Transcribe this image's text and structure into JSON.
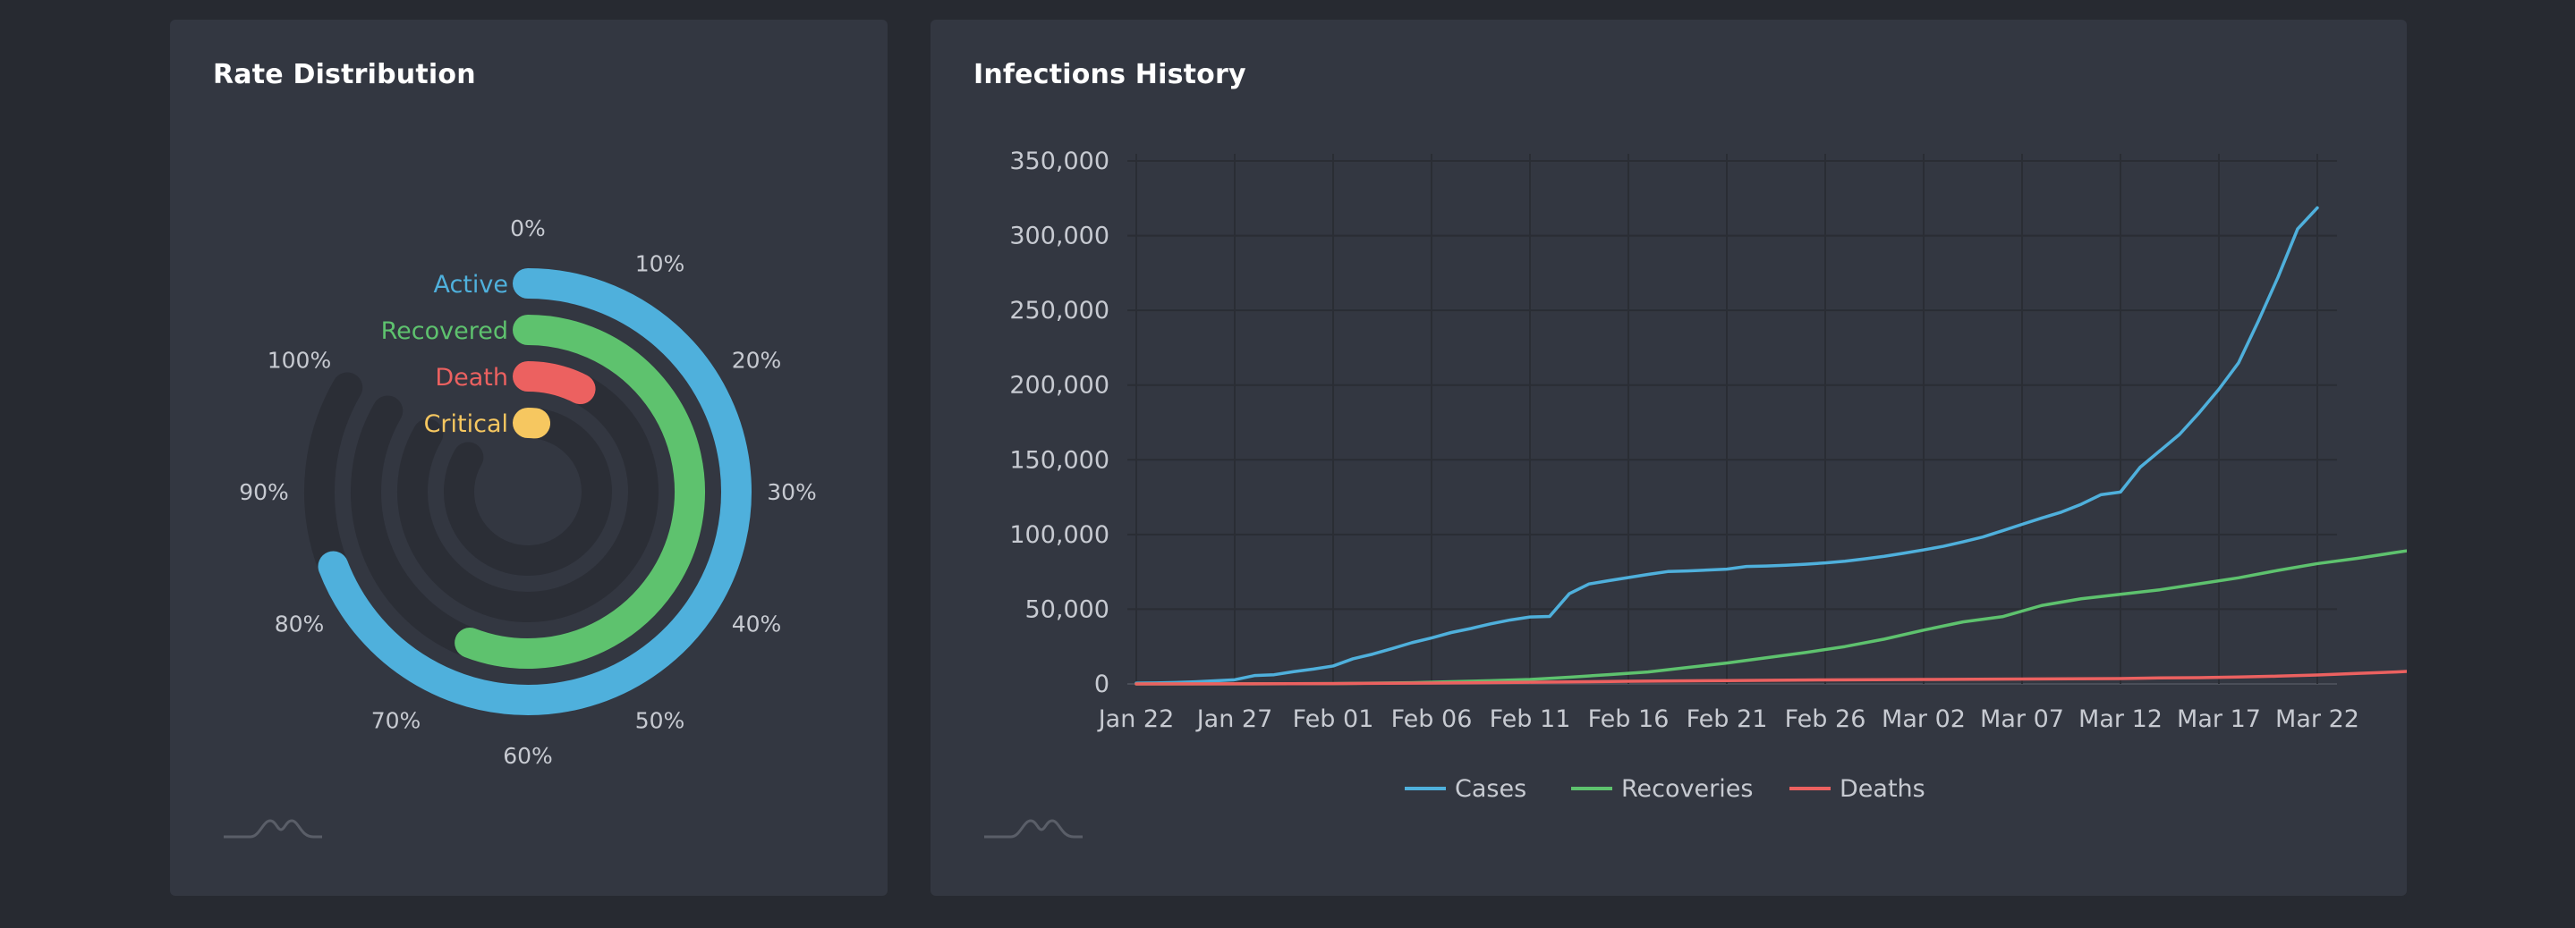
{
  "radial_card": {
    "title": "Rate Distribution"
  },
  "history_card": {
    "title": "Infections History"
  },
  "colors": {
    "background": "#272a31",
    "card": "#333741",
    "cases": "#4fb0dc",
    "recoveries": "#5ec26e",
    "deaths": "#ec6160",
    "critical": "#f6c760",
    "track": "#2b2e36",
    "grid": "#2a2d34",
    "text": "#c7cad1"
  },
  "chart_data": [
    {
      "type": "radialBar",
      "title": "Rate Distribution",
      "angle_axis_labels": [
        "0%",
        "10%",
        "20%",
        "30%",
        "40%",
        "50%",
        "60%",
        "70%",
        "80%",
        "90%",
        "100%"
      ],
      "angle_range_percent": [
        0,
        100
      ],
      "series": [
        {
          "name": "Active",
          "value": 83,
          "color": "#4fb0dc"
        },
        {
          "name": "Recovered",
          "value": 67,
          "color": "#5ec26e"
        },
        {
          "name": "Death",
          "value": 9,
          "color": "#ec6160"
        },
        {
          "name": "Critical",
          "value": 2,
          "color": "#f6c760"
        }
      ]
    },
    {
      "type": "line",
      "title": "Infections History",
      "x_tick_labels": [
        "Jan 22",
        "Jan 27",
        "Feb 01",
        "Feb 06",
        "Feb 11",
        "Feb 16",
        "Feb 21",
        "Feb 26",
        "Mar 02",
        "Mar 07",
        "Mar 12",
        "Mar 17",
        "Mar 22"
      ],
      "y_tick_labels": [
        "0",
        "50,000",
        "100,000",
        "150,000",
        "200,000",
        "250,000",
        "300,000",
        "350,000"
      ],
      "ylim": [
        0,
        350000
      ],
      "x_start": "2020-01-22",
      "grid": true,
      "legend_position": "bottom-center",
      "series": [
        {
          "name": "Cases",
          "color": "#4fb0dc",
          "points": [
            [
              0,
              555
            ],
            [
              1,
              650
            ],
            [
              2,
              940
            ],
            [
              3,
              1430
            ],
            [
              4,
              2120
            ],
            [
              5,
              2800
            ],
            [
              6,
              5580
            ],
            [
              7,
              6170
            ],
            [
              8,
              8240
            ],
            [
              9,
              9930
            ],
            [
              10,
              12000
            ],
            [
              11,
              16800
            ],
            [
              12,
              19900
            ],
            [
              13,
              23700
            ],
            [
              14,
              27600
            ],
            [
              15,
              30800
            ],
            [
              16,
              34400
            ],
            [
              17,
              37100
            ],
            [
              18,
              40200
            ],
            [
              19,
              42800
            ],
            [
              20,
              44800
            ],
            [
              21,
              45200
            ],
            [
              22,
              60400
            ],
            [
              23,
              66900
            ],
            [
              24,
              69100
            ],
            [
              25,
              71200
            ],
            [
              26,
              73300
            ],
            [
              27,
              75200
            ],
            [
              28,
              75600
            ],
            [
              29,
              76200
            ],
            [
              30,
              76800
            ],
            [
              31,
              78600
            ],
            [
              32,
              78900
            ],
            [
              33,
              79400
            ],
            [
              34,
              80100
            ],
            [
              35,
              81000
            ],
            [
              36,
              82100
            ],
            [
              37,
              83700
            ],
            [
              38,
              85400
            ],
            [
              39,
              87500
            ],
            [
              40,
              89700
            ],
            [
              41,
              92100
            ],
            [
              42,
              95100
            ],
            [
              43,
              98300
            ],
            [
              44,
              102500
            ],
            [
              45,
              106800
            ],
            [
              46,
              111000
            ],
            [
              47,
              115000
            ],
            [
              48,
              120200
            ],
            [
              49,
              126600
            ],
            [
              50,
              128400
            ],
            [
              51,
              145000
            ],
            [
              52,
              156000
            ],
            [
              53,
              167000
            ],
            [
              54,
              181500
            ],
            [
              55,
              197200
            ],
            [
              56,
              214900
            ],
            [
              57,
              242700
            ],
            [
              58,
              272100
            ],
            [
              59,
              304500
            ],
            [
              60,
              318600
            ]
          ]
        },
        {
          "name": "Recoveries",
          "color": "#5ec26e",
          "points": [
            [
              0,
              28
            ],
            [
              5,
              60
            ],
            [
              10,
              240
            ],
            [
              12,
              500
            ],
            [
              14,
              800
            ],
            [
              16,
              1500
            ],
            [
              18,
              2200
            ],
            [
              20,
              3000
            ],
            [
              22,
              4500
            ],
            [
              24,
              6200
            ],
            [
              26,
              8000
            ],
            [
              28,
              11000
            ],
            [
              30,
              14000
            ],
            [
              32,
              17500
            ],
            [
              34,
              21000
            ],
            [
              36,
              25000
            ],
            [
              38,
              30000
            ],
            [
              40,
              36000
            ],
            [
              42,
              41500
            ],
            [
              44,
              45000
            ],
            [
              46,
              52500
            ],
            [
              48,
              57000
            ],
            [
              50,
              60000
            ],
            [
              52,
              63000
            ],
            [
              54,
              67000
            ],
            [
              56,
              71000
            ],
            [
              58,
              76000
            ],
            [
              60,
              80500
            ],
            [
              62,
              84000
            ],
            [
              64,
              88000
            ],
            [
              66,
              92000
            ],
            [
              68,
              95000
            ]
          ]
        },
        {
          "name": "Deaths",
          "color": "#ec6160",
          "points": [
            [
              0,
              17
            ],
            [
              5,
              80
            ],
            [
              10,
              260
            ],
            [
              15,
              560
            ],
            [
              20,
              1100
            ],
            [
              25,
              1770
            ],
            [
              30,
              2250
            ],
            [
              35,
              2700
            ],
            [
              40,
              3000
            ],
            [
              45,
              3300
            ],
            [
              50,
              3600
            ],
            [
              52,
              4000
            ],
            [
              54,
              4200
            ],
            [
              56,
              4600
            ],
            [
              58,
              5200
            ],
            [
              60,
              6000
            ],
            [
              62,
              7000
            ],
            [
              64,
              8000
            ],
            [
              66,
              9500
            ],
            [
              67,
              11000
            ],
            [
              68,
              13000
            ],
            [
              69,
              14600
            ]
          ]
        }
      ]
    }
  ]
}
